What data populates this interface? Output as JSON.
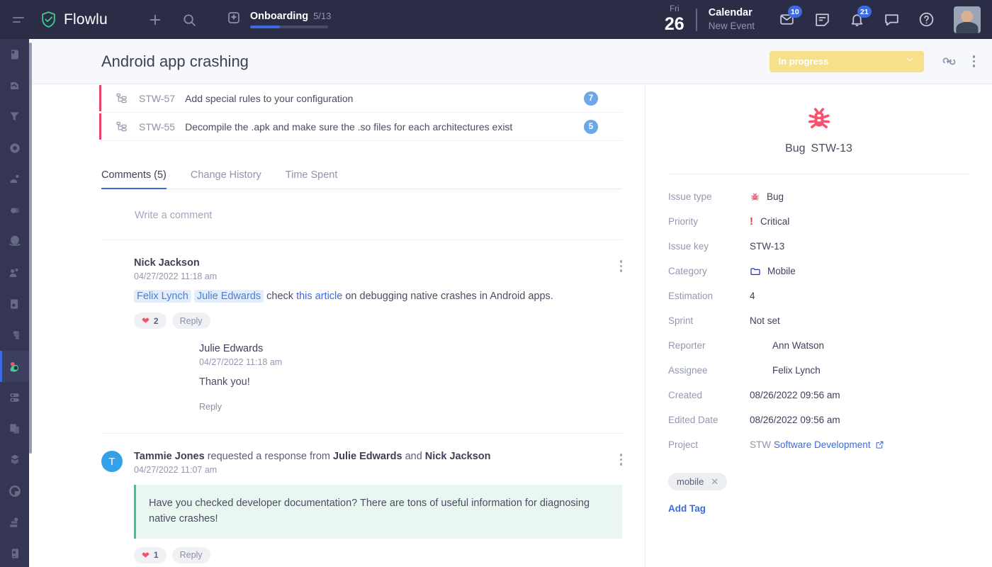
{
  "topbar": {
    "brand": "Flowlu",
    "menu_icon": "hamburger-icon",
    "add_icon": "plus-icon",
    "search_icon": "search-icon",
    "onboarding": {
      "icon": "sparkle-icon",
      "title": "Onboarding",
      "count": "5/13",
      "progress_percent": 38
    },
    "date": {
      "dow": "Fri",
      "day": "26"
    },
    "calendar": {
      "title": "Calendar",
      "subtitle": "New Event"
    },
    "icons": [
      {
        "name": "mail-icon",
        "badge": "10"
      },
      {
        "name": "notes-icon",
        "badge": ""
      },
      {
        "name": "bell-icon",
        "badge": "21"
      },
      {
        "name": "chat-icon",
        "badge": ""
      },
      {
        "name": "help-icon",
        "badge": ""
      }
    ],
    "avatar": "user-avatar"
  },
  "rail": {
    "items": [
      {
        "name": "sidebar-item-favorites",
        "icon": "heart-shield-icon",
        "active": false
      },
      {
        "name": "sidebar-item-feed",
        "icon": "feed-icon",
        "active": false
      },
      {
        "name": "sidebar-item-funnel",
        "icon": "funnel-icon",
        "active": false
      },
      {
        "name": "sidebar-item-analytics",
        "icon": "circle-arrow-icon",
        "active": false
      },
      {
        "name": "sidebar-item-contacts",
        "icon": "contacts-icon",
        "active": false
      },
      {
        "name": "sidebar-item-links",
        "icon": "links-icon",
        "active": false
      },
      {
        "name": "sidebar-item-planet",
        "icon": "planet-icon",
        "active": false
      },
      {
        "name": "sidebar-item-team",
        "icon": "team-icon",
        "active": false
      },
      {
        "name": "sidebar-item-inbox",
        "icon": "inbox-icon",
        "active": false
      },
      {
        "name": "sidebar-item-upload",
        "icon": "upload-icon",
        "active": false
      },
      {
        "name": "sidebar-item-projects",
        "icon": "projects-icon",
        "active": true
      },
      {
        "name": "sidebar-item-toggles",
        "icon": "toggles-icon",
        "active": false
      },
      {
        "name": "sidebar-item-docs",
        "icon": "docs-icon",
        "active": false
      },
      {
        "name": "sidebar-item-deliver",
        "icon": "delivery-icon",
        "active": false
      },
      {
        "name": "sidebar-item-time",
        "icon": "clock-icon",
        "active": false
      },
      {
        "name": "sidebar-item-finance",
        "icon": "finance-icon",
        "active": false
      },
      {
        "name": "sidebar-item-settings",
        "icon": "person-card-icon",
        "active": false
      }
    ]
  },
  "pagehead": {
    "title": "Android app crashing",
    "status": "In progress",
    "status_color": "#f7e08a",
    "link_icon": "link-icon",
    "more_icon": "kebab-menu-icon"
  },
  "tasks": [
    {
      "key": "STW-57",
      "name": "Add special rules to your configuration",
      "count": "7",
      "avatar": "julie-avatar"
    },
    {
      "key": "STW-55",
      "name": "Decompile the .apk and make sure the .so files for each architectures exist",
      "count": "5",
      "avatar": "nick-avatar"
    }
  ],
  "tabs": [
    {
      "label": "Comments (5)",
      "active": true
    },
    {
      "label": "Change History",
      "active": false
    },
    {
      "label": "Time Spent",
      "active": false
    }
  ],
  "write_comment": {
    "placeholder": "Write a comment"
  },
  "comments": [
    {
      "author": "Nick Jackson",
      "time": "04/27/2022 11:18 am",
      "mentions": [
        "Felix Lynch",
        "Julie Edwards"
      ],
      "text_before_link": "check ",
      "link": "this article",
      "text_after_link": " on debugging native crashes in Android apps.",
      "likes": "2",
      "reply": "Reply",
      "replies": [
        {
          "author": "Julie Edwards",
          "time": "04/27/2022 11:18 am",
          "text": "Thank you!",
          "reply": "Reply"
        }
      ]
    },
    {
      "author": "Tammie Jones",
      "author_initial": "T",
      "action_text": " requested a response from ",
      "target1": "Julie Edwards",
      "joiner": " and ",
      "target2": "Nick Jackson",
      "time": "04/27/2022 11:07 am",
      "quote": "Have you checked developer documentation? There are tons of useful information for diagnosing native crashes!",
      "likes": "1",
      "reply": "Reply"
    }
  ],
  "right_panel": {
    "icon": "bug-icon",
    "type_label": "Bug",
    "issue_key_title": "STW-13",
    "properties": [
      {
        "label": "Issue type",
        "value": "Bug",
        "icon": "bug-icon"
      },
      {
        "label": "Priority",
        "value": "Critical",
        "icon": "exclamation-icon"
      },
      {
        "label": "Issue key",
        "value": "STW-13",
        "icon": ""
      },
      {
        "label": "Category",
        "value": "Mobile",
        "icon": "folder-icon"
      },
      {
        "label": "Estimation",
        "value": "4",
        "icon": ""
      },
      {
        "label": "Sprint",
        "value": "Not set",
        "icon": ""
      },
      {
        "label": "Reporter",
        "value": "Ann Watson",
        "icon": "avatar-ann"
      },
      {
        "label": "Assignee",
        "value": "Felix Lynch",
        "icon": "avatar-felix"
      },
      {
        "label": "Created",
        "value": "08/26/2022 09:56 am",
        "icon": ""
      },
      {
        "label": "Edited Date",
        "value": "08/26/2022 09:56 am",
        "icon": ""
      }
    ],
    "project": {
      "label": "Project",
      "prefix": "STW",
      "link": "Software Development",
      "external_icon": "external-link-icon"
    },
    "tags": [
      {
        "label": "mobile",
        "remove_icon": "close-icon"
      }
    ],
    "add_tag": "Add Tag"
  },
  "colors": {
    "accent": "#3d6ae0",
    "bug": "#f8516e",
    "status": "#f7e08a",
    "quote": "#3fc48b",
    "task_bar": "#e8456b"
  }
}
